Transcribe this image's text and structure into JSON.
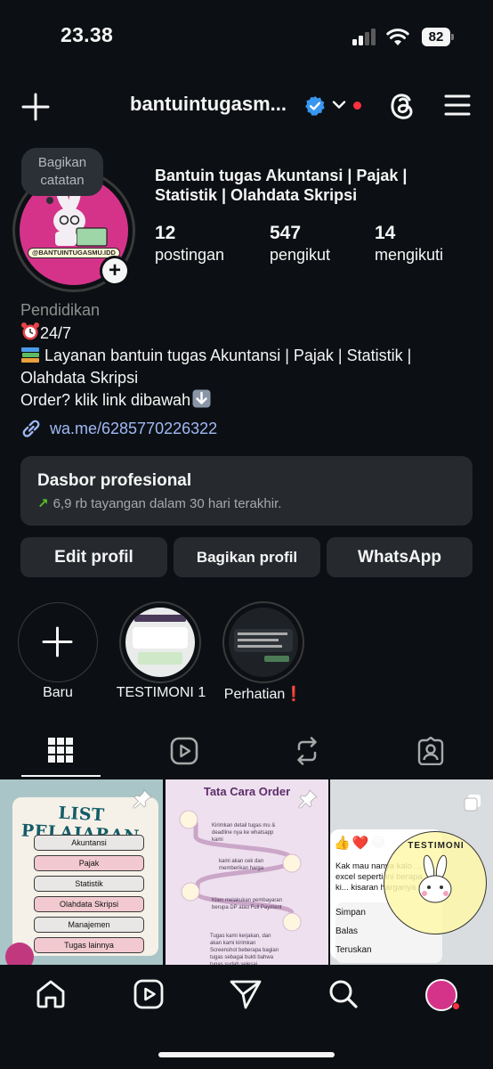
{
  "status_bar": {
    "time": "23.38",
    "battery": "82"
  },
  "header": {
    "username": "bantuintugasm..."
  },
  "profile": {
    "note": "Bagikan catatan",
    "avatar_handle": "@BANTUINTUGASMU.IDD",
    "display_name": "Bantuin tugas Akuntansi | Pajak | Statistik | Olahdata Skripsi",
    "stats": [
      {
        "value": "12",
        "label": "postingan"
      },
      {
        "value": "547",
        "label": "pengikut"
      },
      {
        "value": "14",
        "label": "mengikuti"
      }
    ],
    "category": "Pendidikan",
    "bio_lines": [
      "24/7",
      " Layanan bantuin tugas Akuntansi | Pajak | Statistik |",
      "Olahdata Skripsi",
      "Order? klik link dibawah"
    ],
    "link": "wa.me/6285770226322"
  },
  "dashboard": {
    "title": "Dasbor profesional",
    "subtitle": "6,9 rb tayangan dalam 30 hari terakhir."
  },
  "actions": {
    "edit": "Edit profil",
    "share": "Bagikan profil",
    "whatsapp": "WhatsApp"
  },
  "highlights": [
    {
      "label": "Baru"
    },
    {
      "label": "TESTIMONI 1"
    },
    {
      "label": "Perhatian"
    }
  ],
  "highlight_warning": "❗",
  "posts": {
    "list_pelajaran": {
      "title": "LIST PELAJARAN",
      "items": [
        "Akuntansi",
        "Pajak",
        "Statistik",
        "Olahdata Skripsi",
        "Manajemen",
        "Tugas lainnya"
      ]
    },
    "tata_cara": {
      "title": "Tata Cara Order",
      "steps": [
        "Kirimkan detail tugas mu & deadline nya ke whatsapp kami",
        "kami akan cek dan memberikan harga",
        "Klien melakukan pembayaran berupa DP atau Full Payment",
        "Tugas kami kerjakan, dan akan kami kirimkan Screenshot beberapa bagian tugas sebagai bukti bahwa tugas sudah selesai"
      ]
    },
    "testimoni": {
      "stamp": "TESTIMONI",
      "message": "Kak mau nanya kalo ... excel seperti ini berapa ki... kisaran harganya kak",
      "menu": [
        "Simpan",
        "Balas",
        "Teruskan"
      ]
    }
  }
}
